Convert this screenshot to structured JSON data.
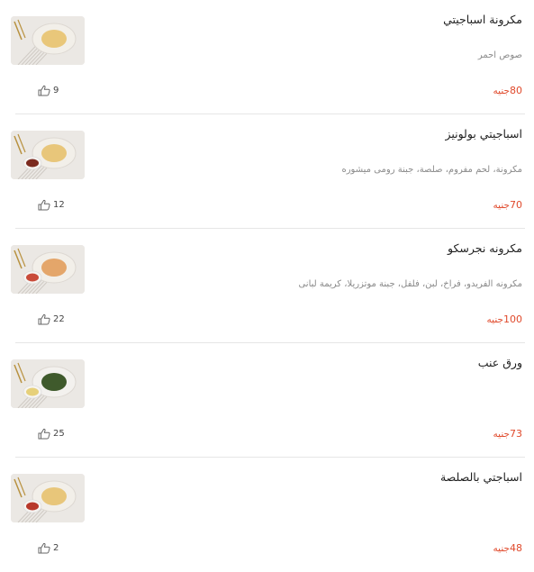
{
  "menu_items": [
    {
      "title": "مكرونة اسباجيتي",
      "description": "صوص احمر",
      "price_value": "80",
      "price_currency": "جنيه",
      "likes": "9",
      "thumb_icon": "pasta-plate-image",
      "plate_color": "#f2efe9",
      "food_color": "#e9c77a",
      "side_color": ""
    },
    {
      "title": "اسباجيتي بولونيز",
      "description": "مكرونة، لحم مفروم، صلصة، جبنة رومى ميشوره",
      "price_value": "70",
      "price_currency": "جنيه",
      "likes": "12",
      "thumb_icon": "bolognese-plate-image",
      "plate_color": "#f2efe9",
      "food_color": "#e8c67a",
      "side_color": "#7b2a1f"
    },
    {
      "title": "مكرونه نجرسكو",
      "description": "مكرونه الفريدو، فراخ، لبن، فلفل، جبنة موتزريلا، كريمة لبانى",
      "price_value": "100",
      "price_currency": "جنيه",
      "likes": "22",
      "thumb_icon": "negresco-plate-image",
      "plate_color": "#f2efe9",
      "food_color": "#e4a66a",
      "side_color": "#c94b3a"
    },
    {
      "title": "ورق عنب",
      "description": "",
      "price_value": "73",
      "price_currency": "جنيه",
      "likes": "25",
      "thumb_icon": "grape-leaves-plate-image",
      "plate_color": "#f3f1ee",
      "food_color": "#3f5a2c",
      "side_color": "#e6d07a"
    },
    {
      "title": "اسباجتي بالصلصة",
      "description": "",
      "price_value": "48",
      "price_currency": "جنيه",
      "likes": "2",
      "thumb_icon": "spaghetti-sauce-plate-image",
      "plate_color": "#f2efe9",
      "food_color": "#e8c67a",
      "side_color": "#b8382b"
    }
  ],
  "colors": {
    "price": "#e0492b",
    "divider": "#e6e6e6"
  },
  "like_icon": "thumbs-up-icon"
}
